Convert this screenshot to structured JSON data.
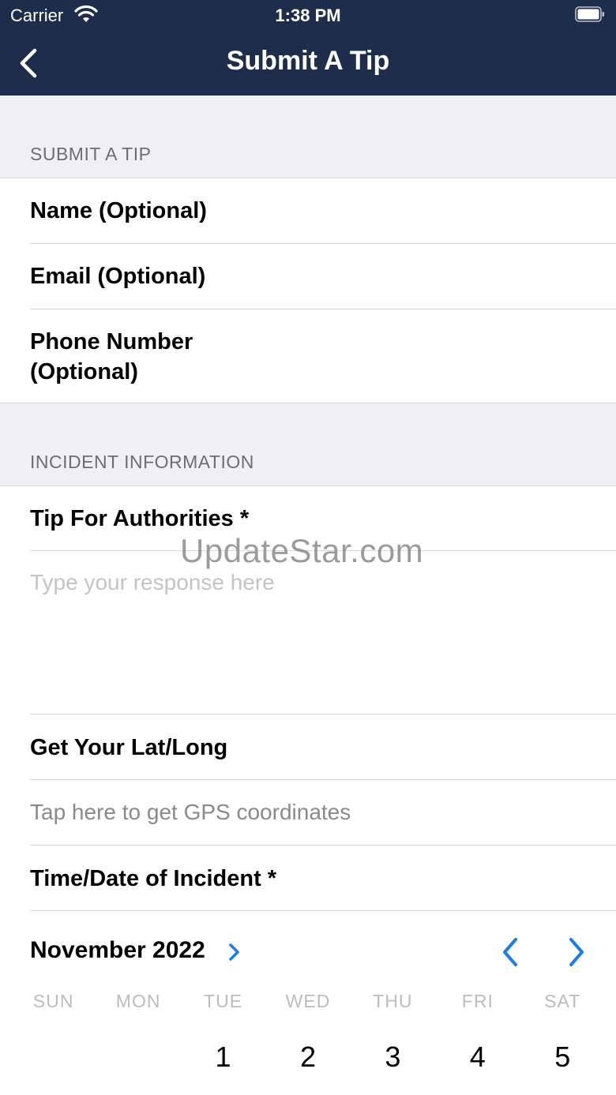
{
  "status_bar": {
    "carrier": "Carrier",
    "time": "1:38 PM"
  },
  "nav": {
    "title": "Submit A Tip"
  },
  "sections": {
    "submit": {
      "header": "SUBMIT A TIP",
      "fields": {
        "name": "Name (Optional)",
        "email": "Email (Optional)",
        "phone_line1": "Phone Number",
        "phone_line2": "(Optional)"
      }
    },
    "incident": {
      "header": "INCIDENT INFORMATION",
      "tip_label": "Tip For Authorities *",
      "tip_placeholder": "Type your response here",
      "latlong_label": "Get Your Lat/Long",
      "gps_prompt": "Tap here to get GPS coordinates",
      "time_label": "Time/Date of Incident *"
    }
  },
  "watermark": "UpdateStar.com",
  "calendar": {
    "month_label": "November 2022",
    "weekdays": [
      "SUN",
      "MON",
      "TUE",
      "WED",
      "THU",
      "FRI",
      "SAT"
    ],
    "first_week": [
      "",
      "",
      "1",
      "2",
      "3",
      "4",
      "5"
    ]
  },
  "colors": {
    "nav_bg": "#1f2d4d",
    "accent": "#1a7de8",
    "section_bg": "#efeff4"
  }
}
